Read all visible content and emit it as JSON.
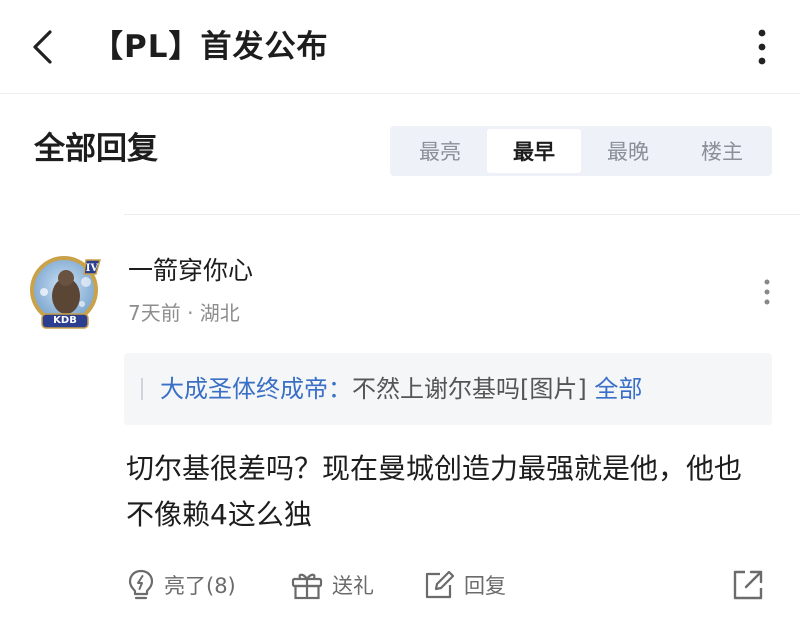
{
  "header": {
    "back_icon": "chevron-left-icon",
    "title": "【PL】首发公布",
    "more_icon": "vertical-ellipsis-icon"
  },
  "section": {
    "title": "全部回复",
    "sort_tabs": [
      {
        "label": "最亮",
        "active": false
      },
      {
        "label": "最早",
        "active": true
      },
      {
        "label": "最晚",
        "active": false
      },
      {
        "label": "楼主",
        "active": false
      }
    ]
  },
  "comment": {
    "avatar_icon": "user-avatar-kdb-badge",
    "avatar_badge_text": "KDB",
    "username": "一箭穿你心",
    "meta": "7天前 · 湖北",
    "quote": {
      "author": "大成圣体终成帝",
      "colon": "：",
      "text": "不然上谢尔基吗[图片]",
      "expand_label": "全部"
    },
    "body": "切尔基很差吗？现在曼城创造力最强就是他，他也不像赖4这么独",
    "actions": {
      "like_label": "亮了(8)",
      "gift_label": "送礼",
      "reply_label": "回复",
      "share_icon": "share-icon"
    }
  },
  "colors": {
    "accent_blue": "#3a6fc6",
    "tab_bg": "#eef1f7",
    "quote_bg": "#f5f6f8",
    "muted_text": "#8d8d8d"
  }
}
